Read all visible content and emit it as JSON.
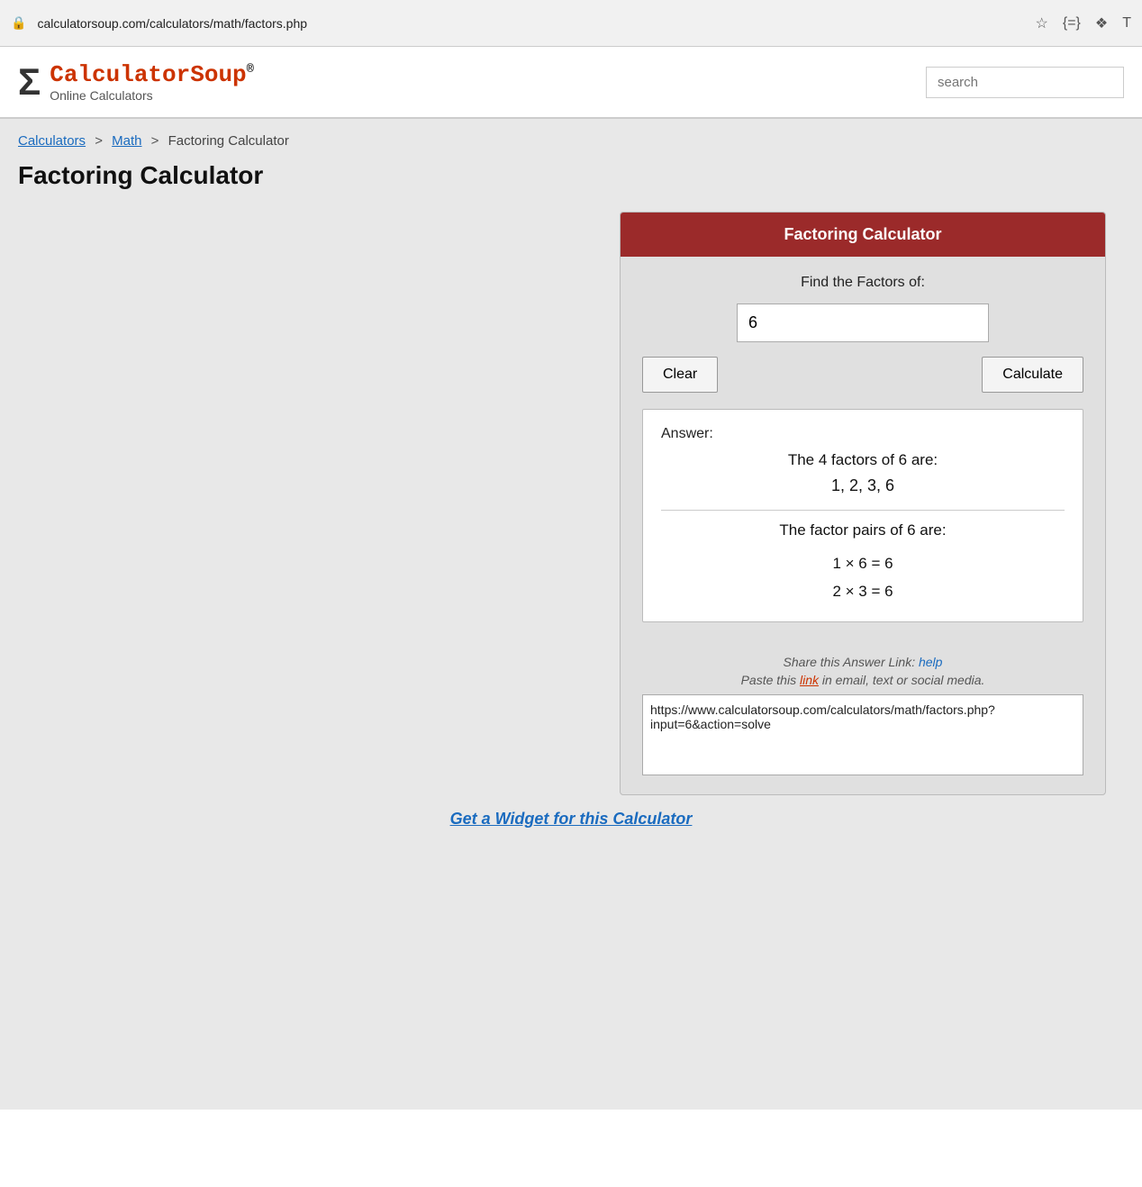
{
  "browser": {
    "url": "calculatorsoup.com/calculators/math/factors.php",
    "search_placeholder": "search"
  },
  "header": {
    "logo_symbol": "Σ",
    "brand_name_part1": "Calculator",
    "brand_name_part2": "Soup",
    "brand_registered": "®",
    "tagline": "Online Calculators"
  },
  "breadcrumb": {
    "calculators": "Calculators",
    "separator1": ">",
    "math": "Math",
    "separator2": ">",
    "current": "Factoring Calculator"
  },
  "page_title": "Factoring Calculator",
  "calculator": {
    "title": "Factoring Calculator",
    "label": "Find the Factors of:",
    "input_value": "6",
    "clear_button": "Clear",
    "calculate_button": "Calculate",
    "answer_label": "Answer:",
    "factors_count_text": "The 4 factors of 6 are:",
    "factors_list": "1, 2, 3, 6",
    "factor_pairs_label": "The factor pairs of 6 are:",
    "factor_pair_1": "1 × 6 = 6",
    "factor_pair_2": "2 × 3 = 6"
  },
  "share": {
    "label": "Share this Answer Link:",
    "help_link": "help",
    "paste_text_before": "Paste this",
    "paste_link_text": "link",
    "paste_text_after": "in email, text or social media.",
    "url": "https://www.calculatorsoup.com/calculators/math/factors.php?input=6&action=solve"
  },
  "widget_link": "Get a Widget for this Calculator"
}
